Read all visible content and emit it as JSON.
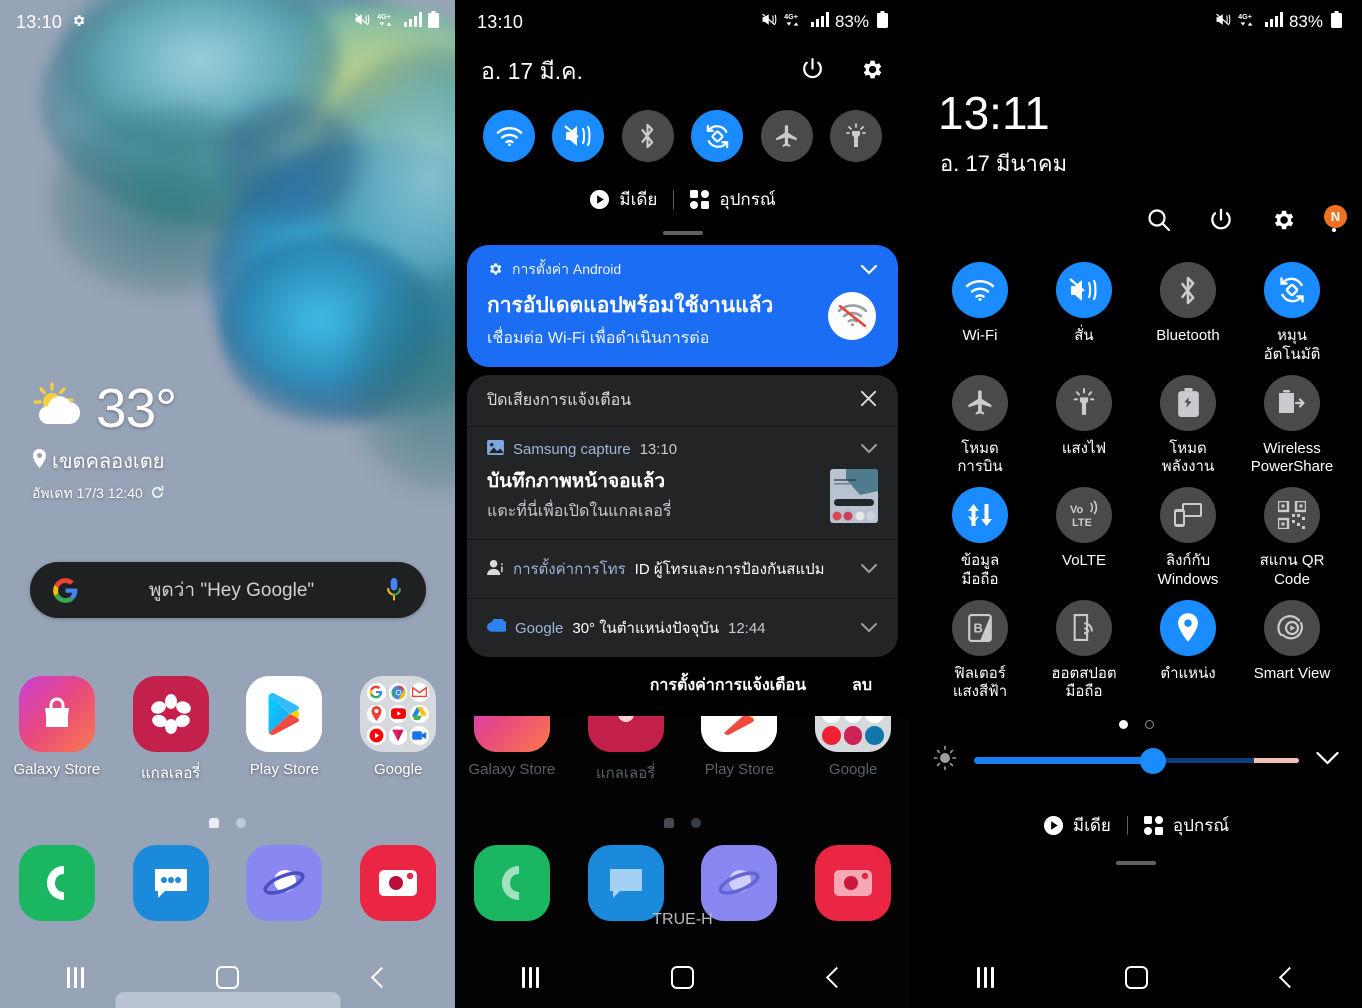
{
  "home": {
    "status_bar": {
      "time": "13:10",
      "gear_icon": "gear-icon",
      "icons": [
        "mute-vibrate-icon",
        "4g-plus-icon",
        "signal-bars-icon",
        "battery-icon"
      ]
    },
    "weather": {
      "temperature": "33°",
      "icon": "sun-cloud-icon",
      "location": "เขตคลองเตย",
      "updated": "อัพเดท 17/3 12:40",
      "refresh_icon": "refresh-icon"
    },
    "search": {
      "hint": "พูดว่า \"Hey Google\"",
      "logo_icon": "google-g-icon",
      "mic_icon": "microphone-icon"
    },
    "apps_row1": [
      {
        "label": "Galaxy Store",
        "icon": "galaxy-store-icon"
      },
      {
        "label": "แกลเลอรี่",
        "icon": "gallery-icon"
      },
      {
        "label": "Play Store",
        "icon": "play-store-icon"
      },
      {
        "label": "Google",
        "icon": "google-folder-icon"
      }
    ],
    "apps_row2": [
      {
        "label": "",
        "icon": "phone-icon"
      },
      {
        "label": "",
        "icon": "messages-icon"
      },
      {
        "label": "",
        "icon": "internet-icon"
      },
      {
        "label": "",
        "icon": "camera-icon"
      }
    ],
    "nav": {
      "recent": "recent-apps-button",
      "home": "home-button",
      "back": "back-button"
    }
  },
  "shade": {
    "status_bar": {
      "time": "13:10",
      "battery_percent": "83%"
    },
    "date": "อ. 17 มี.ค.",
    "power_icon": "power-icon",
    "settings_icon": "gear-icon",
    "toggles": [
      {
        "name": "Wi-Fi",
        "icon": "wifi-icon",
        "on": true
      },
      {
        "name": "สั่น",
        "icon": "vibrate-icon",
        "on": true
      },
      {
        "name": "Bluetooth",
        "icon": "bluetooth-icon",
        "on": false
      },
      {
        "name": "หมุนอัตโนมัติ",
        "icon": "auto-rotate-icon",
        "on": true
      },
      {
        "name": "โหมดการบิน",
        "icon": "airplane-icon",
        "on": false
      },
      {
        "name": "แสงไฟ",
        "icon": "flashlight-icon",
        "on": false
      }
    ],
    "media_label": "มีเดีย",
    "devices_label": "อุปกรณ์",
    "notification_android": {
      "app": "การตั้งค่า Android",
      "app_icon": "gear-icon",
      "title": "การอัปเดตแอปพร้อมใช้งานแล้ว",
      "subtitle": "เชื่อมต่อ Wi-Fi เพื่อดำเนินการต่อ",
      "large_icon": "wifi-off-icon",
      "chevron": "chevron-down-icon"
    },
    "silent_header": {
      "label": "ปิดเสียงการแจ้งเตือน",
      "close_icon": "close-icon"
    },
    "notifications": [
      {
        "app": "Samsung capture",
        "app_icon": "image-icon",
        "time": "13:10",
        "title": "บันทึกภาพหน้าจอแล้ว",
        "subtitle": "แตะที่นี่เพื่อเปิดในแกลเลอรี่",
        "thumb": "screenshot-thumbnail",
        "chevron": "chevron-down-icon"
      },
      {
        "app": "การตั้งค่าการโทร",
        "app_icon": "caller-id-icon",
        "time": "",
        "title": "",
        "subtitle": "",
        "inline": "ID ผู้โทรและการป้องกันสแปม",
        "chevron": "chevron-down-icon"
      },
      {
        "app": "Google",
        "app_icon": "cloud-icon",
        "time": "12:44",
        "title": "",
        "subtitle": "",
        "inline": "30° ในตำแหน่งปัจจุบัน",
        "chevron": "chevron-down-icon"
      }
    ],
    "actions": {
      "settings": "การตั้งค่าการแจ้งเตือน",
      "clear": "ลบ"
    },
    "carrier": "TRUE-H"
  },
  "quick_settings": {
    "status_bar": {
      "battery_percent": "83%"
    },
    "clock": "13:11",
    "date": "อ. 17 มีนาคม",
    "header_icons": [
      {
        "name": "search-icon"
      },
      {
        "name": "power-icon"
      },
      {
        "name": "gear-icon"
      },
      {
        "name": "more-options-icon",
        "badge": "N"
      }
    ],
    "tiles": [
      {
        "label": "Wi-Fi",
        "icon": "wifi-icon",
        "on": true
      },
      {
        "label": "สั่น",
        "icon": "vibrate-icon",
        "on": true
      },
      {
        "label": "Bluetooth",
        "icon": "bluetooth-icon",
        "on": false
      },
      {
        "label": "หมุน\nอัตโนมัติ",
        "icon": "auto-rotate-icon",
        "on": true
      },
      {
        "label": "โหมด\nการบิน",
        "icon": "airplane-icon",
        "on": false
      },
      {
        "label": "แสงไฟ",
        "icon": "flashlight-icon",
        "on": false
      },
      {
        "label": "โหมด\nพลังงาน",
        "icon": "power-saving-icon",
        "on": false
      },
      {
        "label": "Wireless\nPowerShare",
        "icon": "wireless-powershare-icon",
        "on": false
      },
      {
        "label": "ข้อมูล\nมือถือ",
        "icon": "mobile-data-icon",
        "on": true
      },
      {
        "label": "VoLTE",
        "icon": "volte-icon",
        "on": false
      },
      {
        "label": "ลิงก์กับ\nWindows",
        "icon": "link-to-windows-icon",
        "on": false
      },
      {
        "label": "สแกน QR\nCode",
        "icon": "qr-scan-icon",
        "on": false
      },
      {
        "label": "ฟิลเตอร์\nแสงสีฟ้า",
        "icon": "blue-light-filter-icon",
        "on": false
      },
      {
        "label": "ฮอตสปอต\nมือถือ",
        "icon": "mobile-hotspot-icon",
        "on": false
      },
      {
        "label": "ตำแหน่ง",
        "icon": "location-icon",
        "on": true
      },
      {
        "label": "Smart View",
        "icon": "smart-view-icon",
        "on": false
      }
    ],
    "page_dots": {
      "count": 2,
      "active": 0
    },
    "brightness": {
      "icon": "brightness-icon",
      "value": 55,
      "expand_icon": "chevron-down-icon"
    },
    "media_label": "มีเดีย",
    "devices_label": "อุปกรณ์"
  }
}
